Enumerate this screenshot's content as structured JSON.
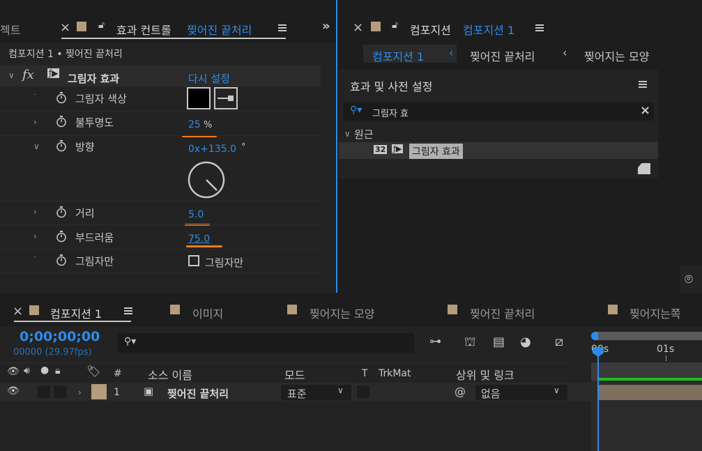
{
  "effect_controls": {
    "left_tab_partial": "젝트",
    "tab_prefix": "효과 컨트롤",
    "tab_layer": "찢어진 끝처리",
    "breadcrumb": "컴포지션 1 • 찢어진 끝처리",
    "fx_label": "fx",
    "effect_name": "그림자 효과",
    "reset_label": "다시 설정",
    "props": [
      {
        "label": "그림자 색상"
      },
      {
        "label": "불투명도",
        "value": "25",
        "unit": "%"
      },
      {
        "label": "방향",
        "value": "0x+135.0",
        "unit": "°"
      },
      {
        "label": "거리",
        "value": "5.0"
      },
      {
        "label": "부드러움",
        "value": "75.0"
      },
      {
        "label": "그림자만",
        "checkbox_label": "그림자만"
      }
    ]
  },
  "composition": {
    "tab_prefix": "컴포지션",
    "tab_name": "컴포지션 1",
    "nav": [
      "컴포지션 1",
      "찢어진 끝처리",
      "찢어지는 모양"
    ]
  },
  "effects_presets": {
    "title": "효과 및 사전 설정",
    "search_value": "그림자 효",
    "category": "원근",
    "item_badge": "32",
    "item_label": "그림자 효과"
  },
  "timeline": {
    "tabs": [
      "컴포지션 1",
      "이미지",
      "찢어지는 모양",
      "찢어진 끝처리",
      "찢어지는쪽"
    ],
    "timecode": "0;00;00;00",
    "fps": "00000 (29.97fps)",
    "ruler": [
      "00s",
      "01s"
    ],
    "columns": {
      "hash": "#",
      "source": "소스 이름",
      "mode": "모드",
      "t": "T",
      "trkmat": "TrkMat",
      "parent": "상위 및 링크"
    },
    "layer": {
      "index": "1",
      "name": "찢어진 끝처리",
      "mode": "표준",
      "parent": "없음"
    }
  },
  "colors": {
    "accent_blue": "#2d8ceb",
    "orange": "#f07c1c",
    "label_tan": "#b49c7c",
    "green": "#1fbf1f"
  }
}
